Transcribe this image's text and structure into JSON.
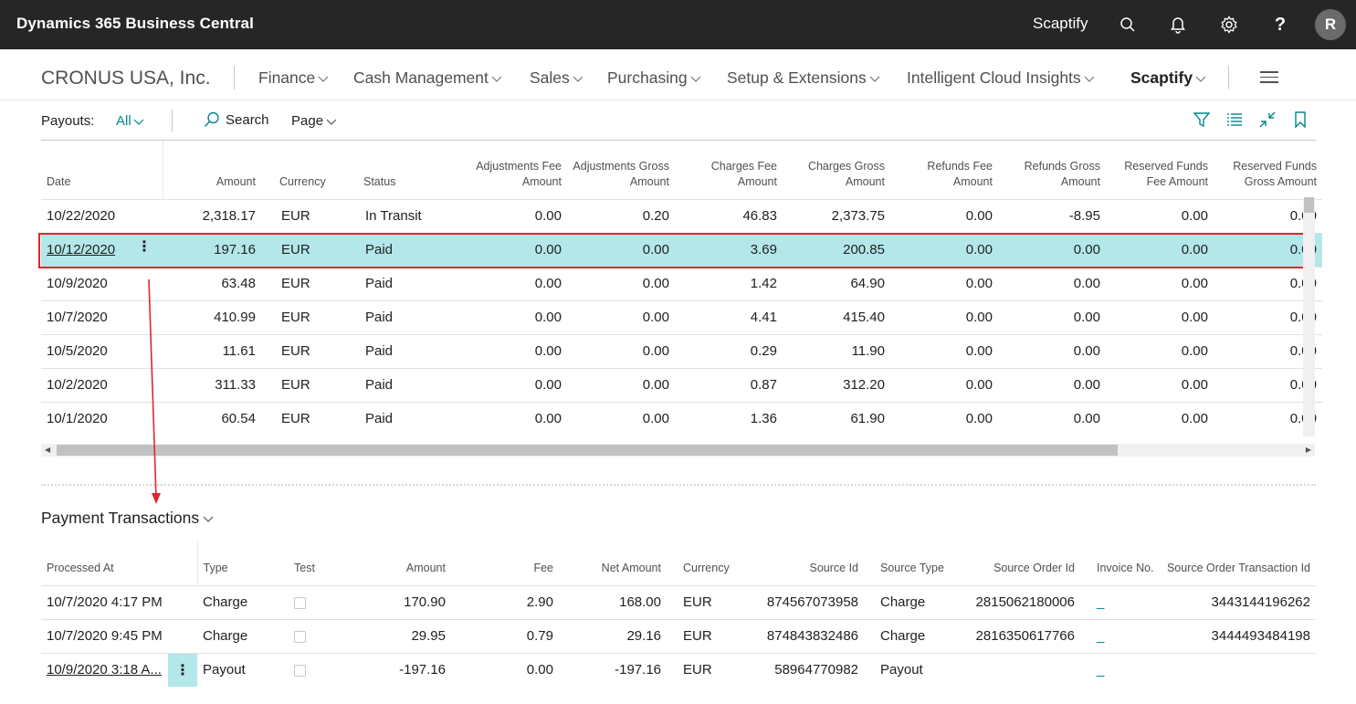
{
  "app": {
    "title": "Dynamics 365 Business Central",
    "company": "Scaptify",
    "avatar_initial": "R"
  },
  "nav": {
    "org": "CRONUS USA, Inc.",
    "items": [
      "Finance",
      "Cash Management",
      "Sales",
      "Purchasing",
      "Setup & Extensions",
      "Intelligent Cloud Insights",
      "Scaptify"
    ],
    "active": "Scaptify"
  },
  "actionbar": {
    "label": "Payouts:",
    "filter": "All",
    "search": "Search",
    "page": "Page"
  },
  "payouts": {
    "columns": [
      "Date",
      "Amount",
      "Currency",
      "Status",
      "Adjustments Fee Amount",
      "Adjustments Gross Amount",
      "Charges Fee Amount",
      "Charges Gross Amount",
      "Refunds Fee Amount",
      "Refunds Gross Amount",
      "Reserved Funds Fee Amount",
      "Reserved Funds Gross Amount"
    ],
    "rows": [
      [
        "10/22/2020",
        "2,318.17",
        "EUR",
        "In Transit",
        "0.00",
        "0.20",
        "46.83",
        "2,373.75",
        "0.00",
        "-8.95",
        "0.00",
        "0.00"
      ],
      [
        "10/12/2020",
        "197.16",
        "EUR",
        "Paid",
        "0.00",
        "0.00",
        "3.69",
        "200.85",
        "0.00",
        "0.00",
        "0.00",
        "0.00"
      ],
      [
        "10/9/2020",
        "63.48",
        "EUR",
        "Paid",
        "0.00",
        "0.00",
        "1.42",
        "64.90",
        "0.00",
        "0.00",
        "0.00",
        "0.00"
      ],
      [
        "10/7/2020",
        "410.99",
        "EUR",
        "Paid",
        "0.00",
        "0.00",
        "4.41",
        "415.40",
        "0.00",
        "0.00",
        "0.00",
        "0.00"
      ],
      [
        "10/5/2020",
        "11.61",
        "EUR",
        "Paid",
        "0.00",
        "0.00",
        "0.29",
        "11.90",
        "0.00",
        "0.00",
        "0.00",
        "0.00"
      ],
      [
        "10/2/2020",
        "311.33",
        "EUR",
        "Paid",
        "0.00",
        "0.00",
        "0.87",
        "312.20",
        "0.00",
        "0.00",
        "0.00",
        "0.00"
      ],
      [
        "10/1/2020",
        "60.54",
        "EUR",
        "Paid",
        "0.00",
        "0.00",
        "1.36",
        "61.90",
        "0.00",
        "0.00",
        "0.00",
        "0.00"
      ]
    ],
    "selected_row": 1
  },
  "transactions": {
    "title": "Payment Transactions",
    "columns": [
      "Processed At",
      "Type",
      "Test",
      "Amount",
      "Fee",
      "Net Amount",
      "Currency",
      "Source Id",
      "Source Type",
      "Source Order Id",
      "Invoice No.",
      "Source Order Transaction Id"
    ],
    "rows": [
      [
        "10/7/2020 4:17 PM",
        "Charge",
        "",
        "170.90",
        "2.90",
        "168.00",
        "EUR",
        "874567073958",
        "Charge",
        "2815062180006",
        "_",
        "3443144196262"
      ],
      [
        "10/7/2020 9:45 PM",
        "Charge",
        "",
        "29.95",
        "0.79",
        "29.16",
        "EUR",
        "874843832486",
        "Charge",
        "2816350617766",
        "_",
        "3444493484198"
      ],
      [
        "10/9/2020 3:18 A...",
        "Payout",
        "",
        "-197.16",
        "0.00",
        "-197.16",
        "EUR",
        "58964770982",
        "Payout",
        "",
        "_",
        ""
      ]
    ]
  },
  "colors": {
    "topbar": "#262626",
    "accent": "#00868b",
    "selection": "#b3e7ea",
    "annotation": "#e0262c"
  }
}
